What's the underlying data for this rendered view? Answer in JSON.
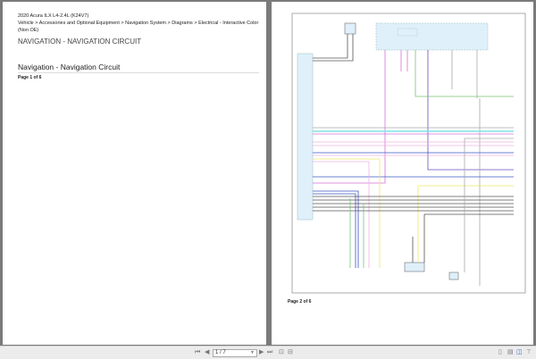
{
  "page1": {
    "vehicle": "2020 Acura ILX L4-2.4L (K24V7)",
    "breadcrumb": "Vehicle > Accessories and Optional Equipment > Navigation System > Diagrams > Electrical - Interactive Color (Non OE)",
    "section_title": "NAVIGATION - NAVIGATION CIRCUIT",
    "doc_title": "Navigation - Navigation Circuit",
    "page_label": "Page 1 of 6"
  },
  "page2": {
    "page_label": "Page 2 of 6"
  },
  "toolbar": {
    "page_value": "1 / 7",
    "icons": [
      "first-page-icon",
      "prev-page-icon",
      "next-page-icon",
      "last-page-icon",
      "fit-page-icon",
      "fit-width-icon",
      "single-page-icon",
      "book-view-icon",
      "two-page-icon",
      "continuous-icon"
    ]
  },
  "colors": {
    "wire_magenta": "#d86fd8",
    "wire_purple": "#6a4fc0",
    "wire_green": "#7cc07a",
    "wire_cyan": "#7fe3e8",
    "wire_yellow": "#ece96a",
    "wire_blue": "#3a56c8",
    "wire_pink": "#f0b4e0",
    "wire_grey": "#555555",
    "component_fill": "#dff0fb"
  }
}
